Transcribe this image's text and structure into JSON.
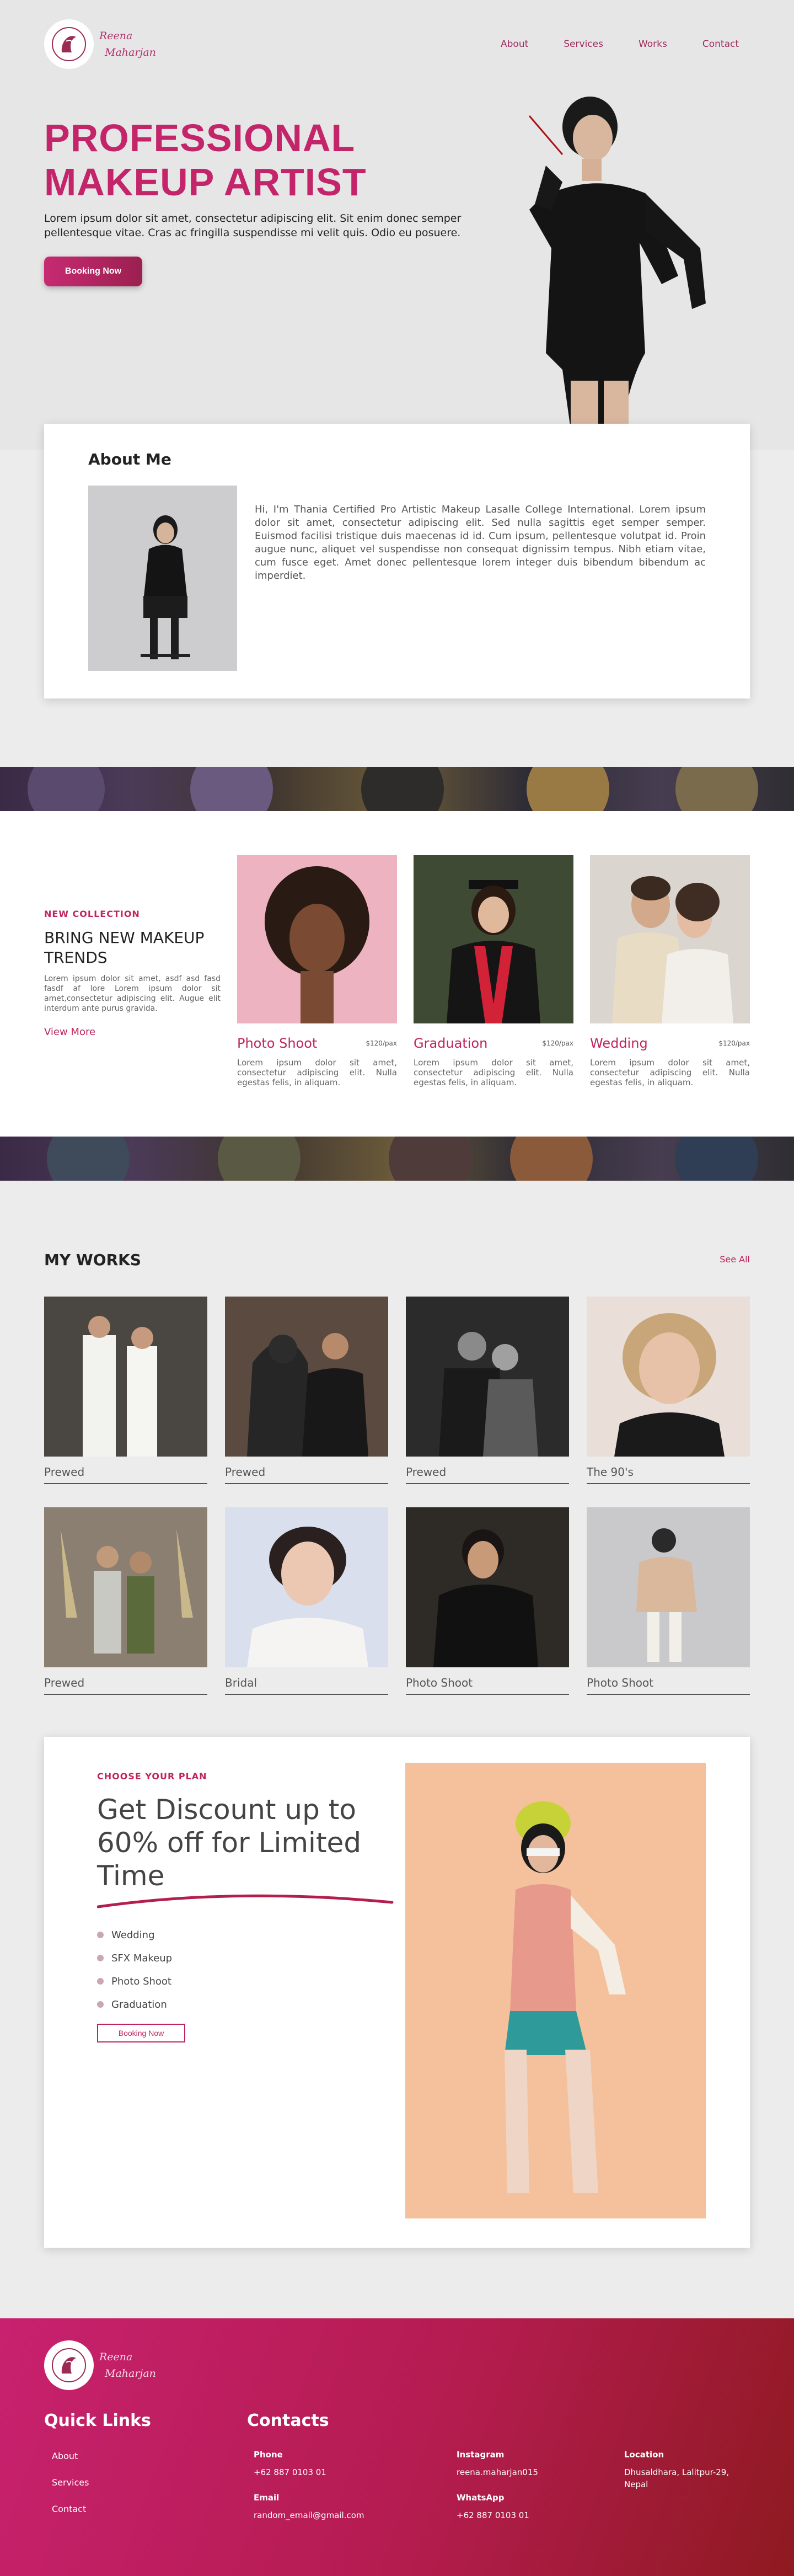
{
  "brand": {
    "line1": "Reena",
    "line2": "Maharjan"
  },
  "nav": {
    "items": [
      "About",
      "Services",
      "Works",
      "Contact"
    ]
  },
  "hero": {
    "title_line1": "PROFESSIONAL",
    "title_line2": "MAKEUP ARTIST",
    "description": "Lorem ipsum dolor sit amet, consectetur adipiscing elit. Sit enim donec semper pellentesque vitae. Cras ac fringilla suspendisse mi velit quis. Odio eu posuere.",
    "button": "Booking Now"
  },
  "about": {
    "title": "About Me",
    "text": "Hi, I'm Thania Certified Pro Artistic Makeup Lasalle College International. Lorem ipsum dolor sit amet, consectetur adipiscing elit. Sed nulla sagittis eget semper semper. Euismod facilisi tristique duis maecenas id id. Cum ipsum, pellentesque volutpat id. Proin augue nunc, aliquet vel suspendisse non consequat dignissim tempus. Nibh etiam vitae, cum fusce eget. Amet donec pellentesque lorem integer duis bibendum bibendum ac imperdiet."
  },
  "collection": {
    "kicker": "NEW COLLECTION",
    "title": "BRING NEW MAKEUP TRENDS",
    "description": "Lorem ipsum dolor sit amet, asdf asd fasd fasdf af lore Lorem ipsum dolor sit amet,consectetur adipiscing elit. Augue elit interdum ante purus gravida.",
    "more": "View More",
    "cards": [
      {
        "name": "Photo Shoot",
        "price": "$120/pax",
        "desc": "Lorem ipsum dolor sit amet, consectetur adipiscing elit. Nulla egestas felis, in aliquam."
      },
      {
        "name": "Graduation",
        "price": "$120/pax",
        "desc": "Lorem ipsum dolor sit amet, consectetur adipiscing elit. Nulla egestas felis, in aliquam."
      },
      {
        "name": "Wedding",
        "price": "$120/pax",
        "desc": "Lorem ipsum dolor sit amet, consectetur adipiscing elit. Nulla egestas felis, in aliquam."
      }
    ]
  },
  "works": {
    "title": "MY WORKS",
    "see_all": "See All",
    "items": [
      "Prewed",
      "Prewed",
      "Prewed",
      "The 90's",
      "Prewed",
      "Bridal",
      "Photo Shoot",
      "Photo Shoot"
    ]
  },
  "discount": {
    "kicker": "CHOOSE YOUR PLAN",
    "title": "Get Discount up to 60% off for Limited Time",
    "plans": [
      "Wedding",
      "SFX Makeup",
      "Photo Shoot",
      "Graduation"
    ],
    "button": "Booking Now"
  },
  "footer": {
    "quick_links_title": "Quick Links",
    "links": [
      "About",
      "Services",
      "Contact"
    ],
    "contacts_title": "Contacts",
    "phone_label": "Phone",
    "phone": "+62 887 0103 01",
    "email_label": "Email",
    "email": "random_email@gmail.com",
    "instagram_label": "Instagram",
    "instagram": "reena.maharjan015",
    "whatsapp_label": "WhatsApp",
    "whatsapp": "+62 887 0103 01",
    "location_label": "Location",
    "location_line1": "Dhusaldhara, Lalitpur-29,",
    "location_line2": "Nepal"
  },
  "colors": {
    "accent": "#c3246a",
    "footer_start": "#c8216f",
    "footer_end": "#8e1a20"
  },
  "icons": [
    "logo-mark-icon",
    "swoosh-underline-icon"
  ]
}
